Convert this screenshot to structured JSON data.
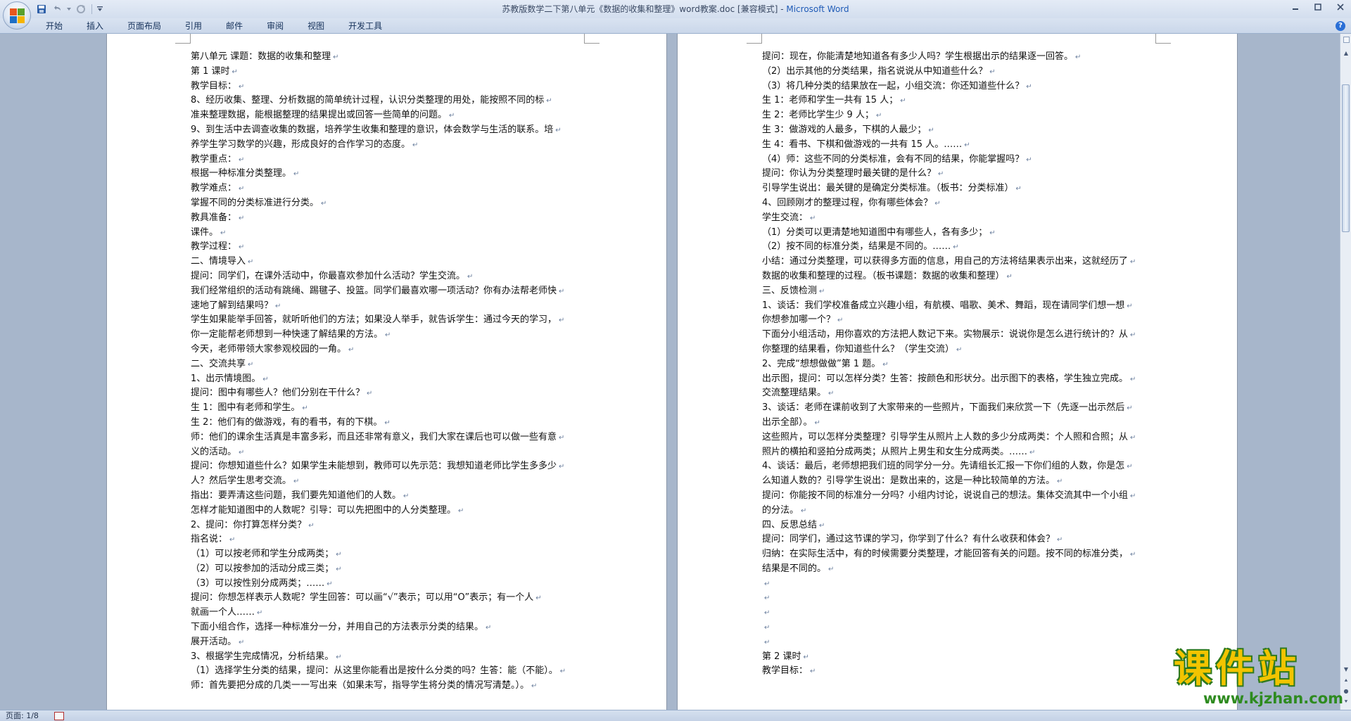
{
  "window": {
    "title": "苏教版数学二下第八单元《数据的收集和整理》word教案.doc [兼容模式] - ",
    "app_name": "Microsoft Word"
  },
  "ribbon": {
    "tabs": [
      "开始",
      "插入",
      "页面布局",
      "引用",
      "邮件",
      "审阅",
      "视图",
      "开发工具"
    ]
  },
  "status": {
    "page_info": "页面: 1/8"
  },
  "watermark": {
    "title": "课件站",
    "url": "www.kjzhan.com"
  },
  "pages": {
    "left": [
      "第八单元 课题：数据的收集和整理",
      "第 1 课时",
      "教学目标：",
      "8、经历收集、整理、分析数据的简单统计过程，认识分类整理的用处，能按照不同的标",
      "准来整理数据，能根据整理的结果提出或回答一些简单的问题。",
      "9、到生活中去调查收集的数据，培养学生收集和整理的意识，体会数学与生活的联系。培",
      "养学生学习数学的兴趣，形成良好的合作学习的态度。",
      "教学重点：",
      "根据一种标准分类整理。",
      "教学难点：",
      "掌握不同的分类标准进行分类。",
      "教具准备：",
      "课件。",
      "教学过程：",
      "二、情境导入",
      "提问：同学们，在课外活动中，你最喜欢参加什么活动？学生交流。",
      "我们经常组织的活动有跳绳、踢毽子、投篮。同学们最喜欢哪一项活动？你有办法帮老师快",
      "速地了解到结果吗？",
      "学生如果能举手回答，就听听他们的方法；如果没人举手，就告诉学生：通过今天的学习，",
      "你一定能帮老师想到一种快速了解结果的方法。",
      "今天，老师带领大家参观校园的一角。",
      "二、交流共享",
      "1、出示情境图。",
      "提问：图中有哪些人？他们分别在干什么？",
      "生 1：图中有老师和学生。",
      "生 2：他们有的做游戏，有的看书，有的下棋。",
      "师：他们的课余生活真是丰富多彩，而且还非常有意义，我们大家在课后也可以做一些有意",
      "义的活动。",
      "提问：你想知道些什么？如果学生未能想到，教师可以先示范：我想知道老师比学生多多少",
      "人？然后学生思考交流。",
      "指出：要弄清这些问题，我们要先知道他们的人数。",
      "怎样才能知道图中的人数呢？引导：可以先把图中的人分类整理。",
      "2、提问：你打算怎样分类？",
      "指名说：",
      "（1）可以按老师和学生分成两类；",
      "（2）可以按参加的活动分成三类；",
      "（3）可以按性别分成两类；……",
      "提问：你想怎样表示人数呢？学生回答：可以画“√”表示；可以用“O”表示；有一个人",
      "就画一个人……",
      "下面小组合作，选择一种标准分一分，并用自己的方法表示分类的结果。",
      "展开活动。",
      "3、根据学生完成情况，分析结果。",
      "（1）选择学生分类的结果，提问：从这里你能看出是按什么分类的吗？生答：能（不能）。",
      "师：首先要把分成的几类一一写出来（如果未写，指导学生将分类的情况写清楚。）。"
    ],
    "right": [
      "提问：现在，你能清楚地知道各有多少人吗？学生根据出示的结果逐一回答。",
      "（2）出示其他的分类结果，指名说说从中知道些什么？",
      "（3）将几种分类的结果放在一起，小组交流：你还知道些什么？",
      "生 1：老师和学生一共有 15 人；",
      "生 2：老师比学生少 9 人；",
      "生 3：做游戏的人最多，下棋的人最少；",
      "生 4：看书、下棋和做游戏的一共有 15 人。……",
      "（4）师：这些不同的分类标准，会有不同的结果，你能掌握吗？",
      "提问：你认为分类整理时最关键的是什么？",
      "引导学生说出：最关键的是确定分类标准。（板书：分类标准）",
      "4、回顾刚才的整理过程，你有哪些体会？",
      "学生交流：",
      "（1）分类可以更清楚地知道图中有哪些人，各有多少；",
      "（2）按不同的标准分类，结果是不同的。……",
      "小结：通过分类整理，可以获得多方面的信息，用自己的方法将结果表示出来，这就经历了",
      "数据的收集和整理的过程。（板书课题：数据的收集和整理）",
      "三、反馈检测",
      "1、谈话：我们学校准备成立兴趣小组，有航模、唱歌、美术、舞蹈，现在请同学们想一想",
      "你想参加哪一个？",
      "下面分小组活动，用你喜欢的方法把人数记下来。实物展示：说说你是怎么进行统计的？从",
      "你整理的结果看，你知道些什么？（学生交流）",
      "2、完成“想想做做”第 1 题。",
      "出示图，提问：可以怎样分类？生答：按颜色和形状分。出示图下的表格，学生独立完成。",
      "交流整理结果。",
      "3、谈话：老师在课前收到了大家带来的一些照片，下面我们来欣赏一下（先逐一出示然后",
      "出示全部）。",
      "这些照片，可以怎样分类整理？引导学生从照片上人数的多少分成两类：个人照和合照；从",
      "照片的横拍和竖拍分成两类；从照片上男生和女生分成两类。……",
      "4、谈话：最后，老师想把我们班的同学分一分。先请组长汇报一下你们组的人数，你是怎",
      "么知道人数的？引导学生说出：是数出来的，这是一种比较简单的方法。",
      "提问：你能按不同的标准分一分吗？小组内讨论，说说自己的想法。集体交流其中一个小组",
      "的分法。",
      "四、反思总结",
      "提问：同学们，通过这节课的学习，你学到了什么？有什么收获和体会？",
      "归纳：在实际生活中，有的时候需要分类整理，才能回答有关的问题。按不同的标准分类，",
      "结果是不同的。",
      "",
      "",
      "",
      "",
      "",
      "第 2 课时",
      "教学目标："
    ]
  },
  "colors": {
    "title_accent": "#1f5bb7",
    "workspace": "#a7b6cb",
    "watermark_yellow": "#f2c400",
    "watermark_green": "#2e8b1f"
  }
}
